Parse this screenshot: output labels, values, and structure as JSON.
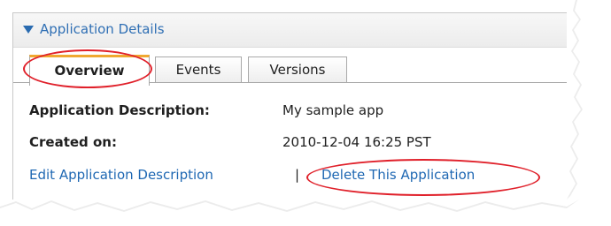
{
  "panel": {
    "title": "Application Details"
  },
  "tabs": [
    {
      "label": "Overview",
      "active": true
    },
    {
      "label": "Events",
      "active": false
    },
    {
      "label": "Versions",
      "active": false
    }
  ],
  "details": {
    "description_label": "Application Description:",
    "description_value": "My sample app",
    "created_label": "Created on:",
    "created_value": "2010-12-04 16:25 PST"
  },
  "actions": {
    "edit_label": "Edit Application Description",
    "separator": "|",
    "delete_label": "Delete This Application"
  },
  "colors": {
    "link": "#1f68b3",
    "header_title": "#2f6fb4",
    "annotation": "#e0202a",
    "active_tab_accent": "#f0a830"
  }
}
